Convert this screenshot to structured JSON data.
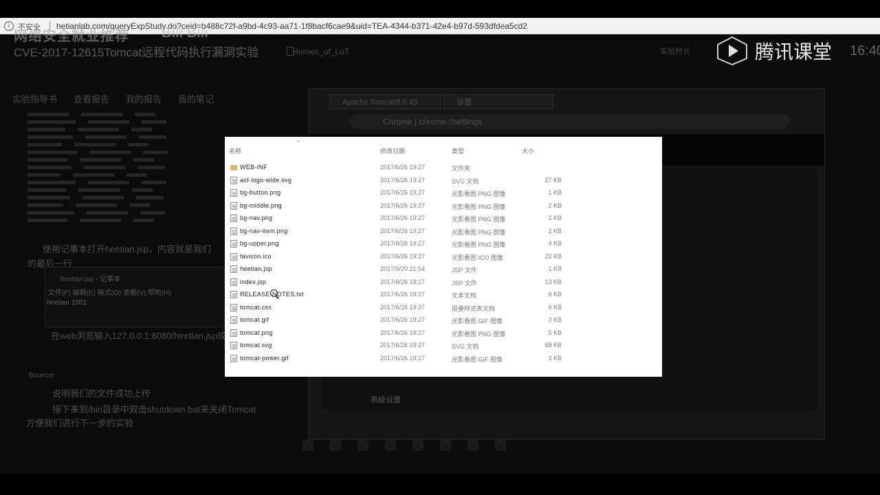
{
  "address_bar": {
    "security_label": "不安全",
    "url": "hetianlab.com/queryExpStudy.do?ceid=b488c72f-a9bd-4c93-aa71-1f8bacf6cae9&uid=TEA-4344-b371-42e4-b97d-593dfdea5cd2"
  },
  "overlay": {
    "title": "网络安全就业推荐",
    "bili_mark": "Bili Bili"
  },
  "watermark": {
    "brand": "腾讯课堂"
  },
  "background_page": {
    "title": "CVE-2017-12615Tomcat远程代码执行漏洞实验",
    "user": "Heroes_of_LuT",
    "experience_label": "实验时长",
    "time": "16:40",
    "tabs": [
      "实验指导书",
      "查看报告",
      "我的报告",
      "我的笔记"
    ],
    "step1": "使用记事本打开heetian.jsp，内容就是我们",
    "step1b": "的最后一行",
    "notepad_title": "heetian.jsp - 记事本",
    "notepad_menu": "文件(F)  编辑(E)  格式(O)  查看(V)  帮助(H)",
    "notepad_body": "heetian 1001",
    "step2": "在web浏览输入127.0.0.1:8080/heetian.jsp成功",
    "section": "Bouncer",
    "step3": "说明我们的文件成功上传",
    "step4": "接下来到/bin目录中双击shutdown.bat来关闭Tomcat",
    "step5": "方便我们进行下一步的实验"
  },
  "browser": {
    "tab1": "Apache Tomcat/8.0.43",
    "tab2": "设置",
    "omnibox_label": "Chrome",
    "omnibox_url": "chrome://settings",
    "advanced": "高级设置"
  },
  "explorer": {
    "columns": {
      "name": "名称",
      "date": "修改日期",
      "type": "类型",
      "size": "大小"
    },
    "files": [
      {
        "name": "WEB-INF",
        "date": "2017/6/26 19:27",
        "type": "文件夹",
        "size": "",
        "kind": "folder"
      },
      {
        "name": "asf-logo-wide.svg",
        "date": "2017/6/26 19:27",
        "type": "SVG 文档",
        "size": "27 KB",
        "kind": "file"
      },
      {
        "name": "bg-button.png",
        "date": "2017/6/26 19:27",
        "type": "光影看图 PNG 图像",
        "size": "1 KB",
        "kind": "file"
      },
      {
        "name": "bg-middle.png",
        "date": "2017/6/26 19:27",
        "type": "光影看图 PNG 图像",
        "size": "2 KB",
        "kind": "file"
      },
      {
        "name": "bg-nav.png",
        "date": "2017/6/26 19:27",
        "type": "光影看图 PNG 图像",
        "size": "2 KB",
        "kind": "file"
      },
      {
        "name": "bg-nav-item.png",
        "date": "2017/6/26 19:27",
        "type": "光影看图 PNG 图像",
        "size": "2 KB",
        "kind": "file"
      },
      {
        "name": "bg-upper.png",
        "date": "2017/6/26 19:27",
        "type": "光影看图 PNG 图像",
        "size": "4 KB",
        "kind": "file"
      },
      {
        "name": "favicon.ico",
        "date": "2017/6/26 19:27",
        "type": "光影看图 ICO 图像",
        "size": "22 KB",
        "kind": "file"
      },
      {
        "name": "heetian.jsp",
        "date": "2017/9/20 21:54",
        "type": "JSP 文件",
        "size": "1 KB",
        "kind": "file"
      },
      {
        "name": "index.jsp",
        "date": "2017/6/26 19:27",
        "type": "JSP 文件",
        "size": "13 KB",
        "kind": "file"
      },
      {
        "name": "RELEASE-NOTES.txt",
        "date": "2017/6/26 19:27",
        "type": "文本文档",
        "size": "9 KB",
        "kind": "file"
      },
      {
        "name": "tomcat.css",
        "date": "2017/6/26 19:27",
        "type": "层叠样式表文档",
        "size": "6 KB",
        "kind": "file"
      },
      {
        "name": "tomcat.gif",
        "date": "2017/6/26 19:27",
        "type": "光影看图 GIF 图像",
        "size": "3 KB",
        "kind": "file"
      },
      {
        "name": "tomcat.png",
        "date": "2017/6/26 19:27",
        "type": "光影看图 PNG 图像",
        "size": "5 KB",
        "kind": "file"
      },
      {
        "name": "tomcat.svg",
        "date": "2017/6/26 19:27",
        "type": "SVG 文档",
        "size": "68 KB",
        "kind": "file"
      },
      {
        "name": "tomcat-power.gif",
        "date": "2017/6/26 19:27",
        "type": "光影看图 GIF 图像",
        "size": "3 KB",
        "kind": "file"
      }
    ]
  }
}
